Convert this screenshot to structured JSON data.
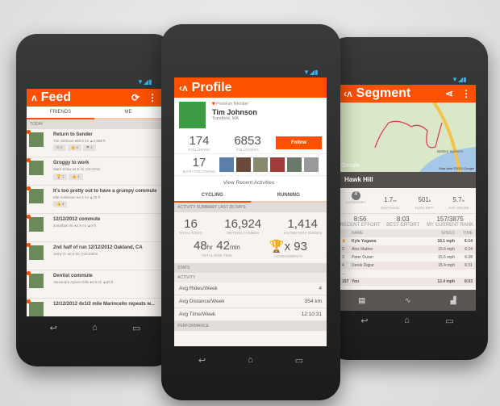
{
  "feed": {
    "title": "Feed",
    "tabs": [
      "FRIENDS",
      "ME"
    ],
    "section": "TODAY",
    "items": [
      {
        "title": "Return to Sender",
        "meta": "Tim Johnson  ♦60.5 mi  ▲2,568 ft",
        "badges": [
          "✉ 2",
          "👍 4",
          "⚑ 1"
        ]
      },
      {
        "title": "Groggy to work",
        "meta": "Mark Shaw  ♦2.8 mi  ◷8:22/mi",
        "badges": [
          "🏆 1",
          "👍 1"
        ]
      },
      {
        "title": "It's too pretty out to have a grumpy commute",
        "meta": "Elle Anderson  ♦4.3 mi  ▲78 ft",
        "badges": [
          "👍 4"
        ]
      },
      {
        "title": "12/12/2012 commute",
        "meta": "Jonathan W.  ♦2.9 mi  ▲0 ft",
        "badges": []
      },
      {
        "title": "2nd half of run 12/12/2012 Oakland, CA",
        "meta": "Jamy G.  ♦2.0 mi  ◷10:33/mi",
        "badges": []
      },
      {
        "title": "Dentist commute",
        "meta": "Alexandre Aybes-Gille  ♦4.8 mi  ▲55 ft",
        "badges": []
      },
      {
        "title": "12/12/2012 4x1/2 mile Marincello repeats w...",
        "meta": "",
        "badges": []
      }
    ]
  },
  "profile": {
    "title": "Profile",
    "badge": "Premium Member",
    "name": "Tim Johnson",
    "location": "Topsfield, MA",
    "following": "174",
    "following_label": "FOLLOWING",
    "followers": "6853",
    "followers_label": "FOLLOWERS",
    "follow_button": "Follow",
    "both": "17",
    "both_label": "BOTH FOLLOWING",
    "view_recent": "View Recent Activities",
    "tabs": [
      "CYCLING",
      "RUNNING"
    ],
    "summary_header": "ACTIVITY SUMMARY LAST 28 DAYS",
    "rides": "16",
    "rides_label": "TOTAL RIDES",
    "climbed": "16,924",
    "climbed_label": "METERS CLIMBED",
    "km": "1,414",
    "km_label": "KILOMETERS RIDDEN",
    "hr": "48",
    "hr_unit": "hr",
    "min": "42",
    "min_unit": "min",
    "time_label": "TOTAL RIDE TIME",
    "ach": "x 93",
    "ach_label": "ACHIEVEMENTS",
    "stats_header": "STATS",
    "activity_header": "ACTIVITY",
    "stats": [
      {
        "label": "Avg Rides/Week",
        "value": "4"
      },
      {
        "label": "Avg Distance/Week",
        "value": "354 km"
      },
      {
        "label": "Avg Time/Week",
        "value": "12:10:31"
      }
    ],
    "performance_header": "PERFORMANCE"
  },
  "segment": {
    "title": "Segment",
    "map_label": "Battery Spencer",
    "map_credit": "Map data ©2012 Google",
    "google": "Google",
    "name": "Hawk Hill",
    "category": "4",
    "category_label": "CATEGORY",
    "distance": "1.7",
    "distance_unit": "mi",
    "distance_label": "DISTANCE",
    "elev": "501",
    "elev_unit": "ft",
    "elev_label": "ELEV DIFF",
    "grade": "5.7",
    "grade_unit": "%",
    "grade_label": "AVG GRADE",
    "recent": "8:56",
    "recent_label": "RECENT EFFORT",
    "best": "8:03",
    "best_label": "BEST EFFORT",
    "rank": "157/3875",
    "rank_label": "MY CURRENT RANK",
    "cols": [
      "NAME",
      "SPEED",
      "TIME"
    ],
    "rows": [
      {
        "rank": "♛",
        "name": "Kyle Yugawa",
        "speed": "16.1 mph",
        "time": "6:14"
      },
      {
        "rank": "2",
        "name": "Alex Mather",
        "speed": "15.6 mph",
        "time": "6:24"
      },
      {
        "rank": "3",
        "name": "Peter Duran",
        "speed": "15.5 mph",
        "time": "6:28"
      },
      {
        "rank": "4",
        "name": "Derek Digiar",
        "speed": "15.4 mph",
        "time": "6:31"
      },
      {
        "rank": "...",
        "name": "",
        "speed": "",
        "time": ""
      },
      {
        "rank": "157",
        "name": "You",
        "speed": "12.4 mph",
        "time": "8:03"
      }
    ]
  },
  "colors": {
    "accent": "#fc5200"
  }
}
